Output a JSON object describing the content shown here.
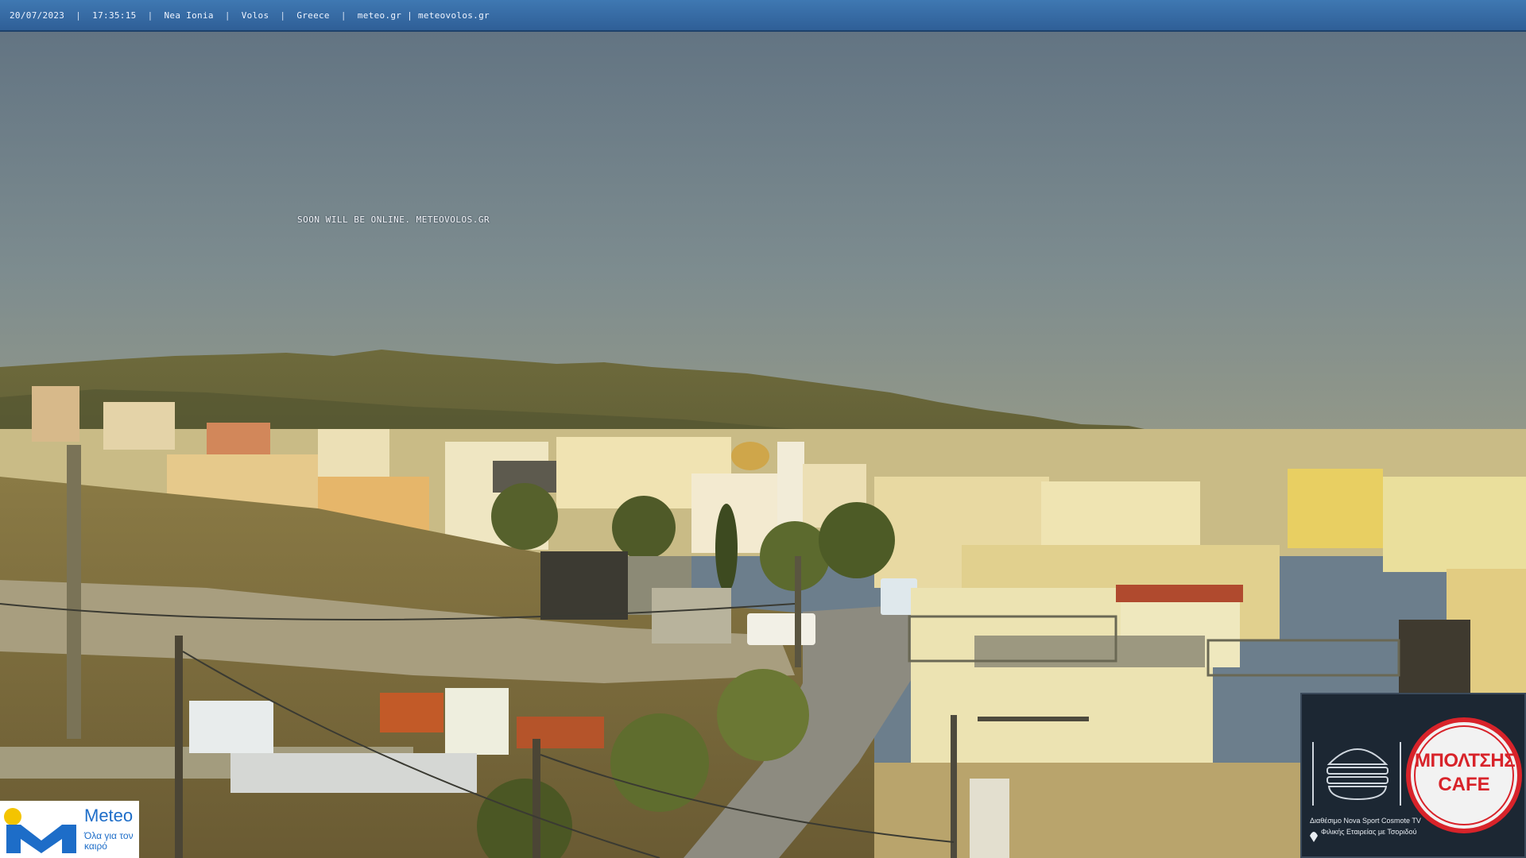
{
  "overlay": {
    "date": "20/07/2023",
    "time": "17:35:15",
    "area": "Nea Ionia",
    "city": "Volos",
    "country": "Greece",
    "sites": "meteo.gr | meteovolos.gr",
    "separator": "|"
  },
  "announcement": "SOON WILL BE ONLINE. METEOVOLOS.GR",
  "logo": {
    "brand": "Meteo",
    "slogan": "Όλα για τον καιρό",
    "icon": "meteo-m-logo-icon"
  },
  "ad": {
    "name": "ΜΠΟΛΤΣΗΣ",
    "sub": "CAFE",
    "line1": "Διαθέσιμο Nova Sport  Cosmote TV",
    "line2": "Φιλικής Εταιρείας με Τσοριδού",
    "icon": "burger-icon"
  },
  "colors": {
    "bar": "#3a6ea8",
    "sky": "#6f8190",
    "logo_blue": "#1d6dc8",
    "logo_yellow": "#f4c400",
    "ad_red": "#d8232a"
  }
}
